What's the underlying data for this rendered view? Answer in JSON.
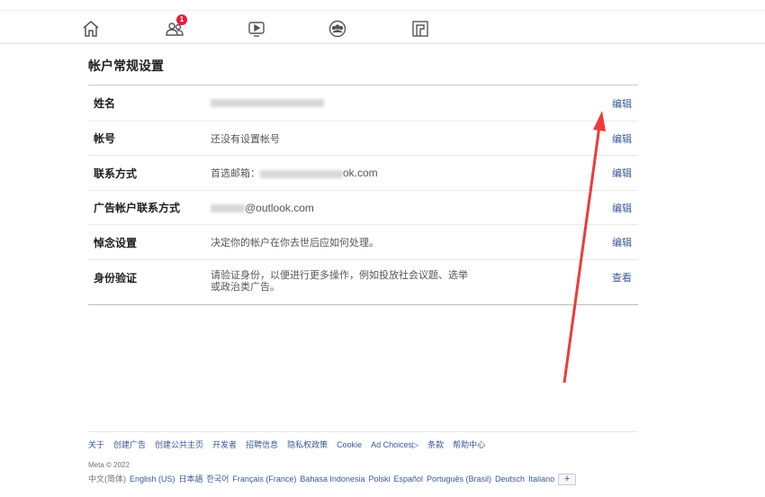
{
  "nav": {
    "friends_badge": "1"
  },
  "page_title": "帐户常规设置",
  "rows": [
    {
      "label": "姓名",
      "value": "",
      "action": "编辑"
    },
    {
      "label": "帐号",
      "value": "还没有设置帐号",
      "action": "编辑"
    },
    {
      "label": "联系方式",
      "value_prefix": "首选邮箱：",
      "value_suffix": "ok.com",
      "action": "编辑"
    },
    {
      "label": "广告帐户联系方式",
      "value_suffix": "@outlook.com",
      "action": "编辑"
    },
    {
      "label": "悼念设置",
      "value": "决定你的帐户在你去世后应如何处理。",
      "action": "编辑"
    },
    {
      "label": "身份验证",
      "value": "请验证身份，以便进行更多操作，例如投放社会议题、选举或政治类广告。",
      "action": "查看"
    }
  ],
  "footer": {
    "links": [
      "关于",
      "创建广告",
      "创建公共主页",
      "开发者",
      "招聘信息",
      "隐私权政策",
      "Cookie",
      "Ad Choices▷",
      "条款",
      "帮助中心"
    ],
    "copyright": "Meta © 2022",
    "current_language": "中文(简体)",
    "languages": [
      "English (US)",
      "日本語",
      "한국어",
      "Français (France)",
      "Bahasa Indonesia",
      "Polski",
      "Español",
      "Português (Brasil)",
      "Deutsch",
      "Italiano"
    ],
    "more": "+"
  },
  "colors": {
    "link": "#385898",
    "arrow": "#f03a3a",
    "badge": "#e41e3f"
  }
}
